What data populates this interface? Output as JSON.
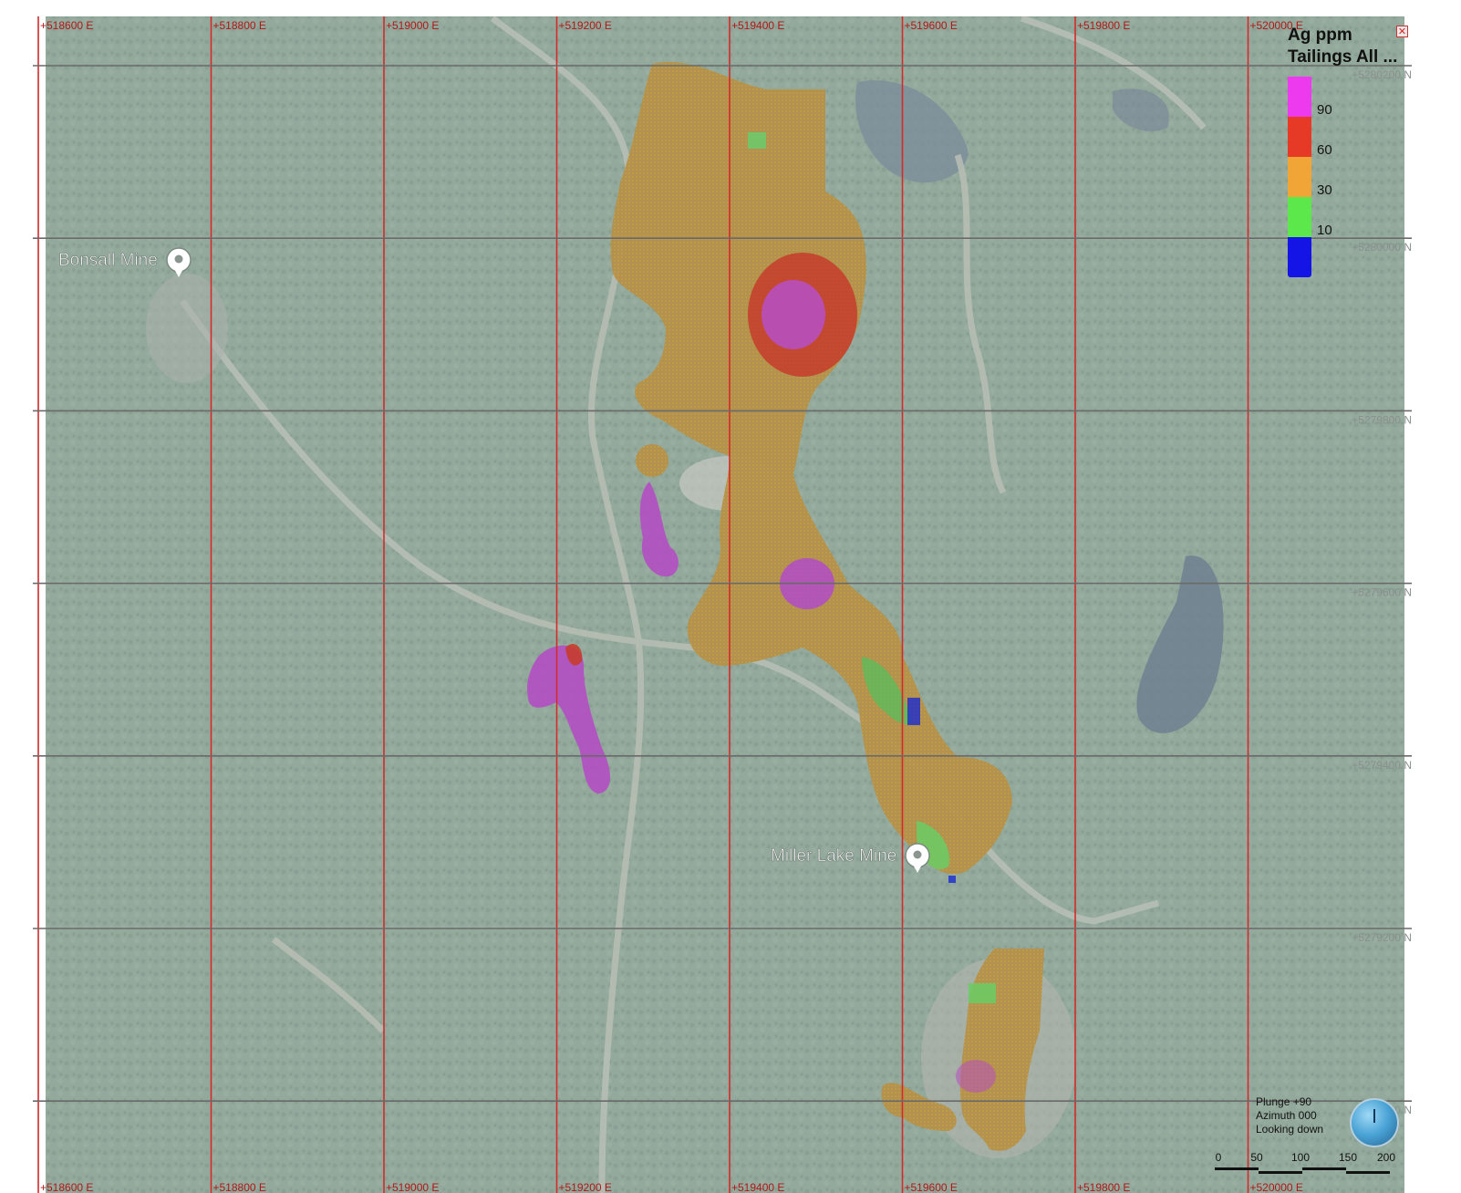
{
  "map": {
    "places": [
      {
        "label": "Bonsall Mine"
      },
      {
        "label": "Miller Lake Mine"
      }
    ],
    "easting_labels": [
      "+518600 E",
      "+518800 E",
      "+519000 E",
      "+519200 E",
      "+519400 E",
      "+519600 E",
      "+519800 E",
      "+520000 E"
    ],
    "northing_labels": [
      "+5280200 N",
      "+5280000 N",
      "+5279800 N",
      "+5279600 N",
      "+5279400 N",
      "+5279200 N",
      "+5279000 N"
    ],
    "colors": {
      "grid_vertical": "#d42a2a",
      "grid_horizontal": "#6a6a6a",
      "label_red": "#b01818",
      "label_grey": "#8a8f8f",
      "forest": "#8ba494",
      "tailings_base": "#a99155"
    }
  },
  "legend": {
    "title_line1": "Ag ppm",
    "title_line2": "Tailings All ...",
    "close_icon": "close-icon",
    "entries": [
      {
        "label": "90",
        "color": "#ee3aee"
      },
      {
        "label": "60",
        "color": "#e63a26"
      },
      {
        "label": "30",
        "color": "#f0a536"
      },
      {
        "label": "10",
        "color": "#5ce84a"
      }
    ],
    "bottom_color": "#1414e6"
  },
  "view": {
    "plunge": "Plunge +90",
    "azimuth": "Azimuth 000",
    "looking": "Looking down"
  },
  "scale": {
    "ticks": [
      "0",
      "50",
      "100",
      "150",
      "200"
    ]
  }
}
